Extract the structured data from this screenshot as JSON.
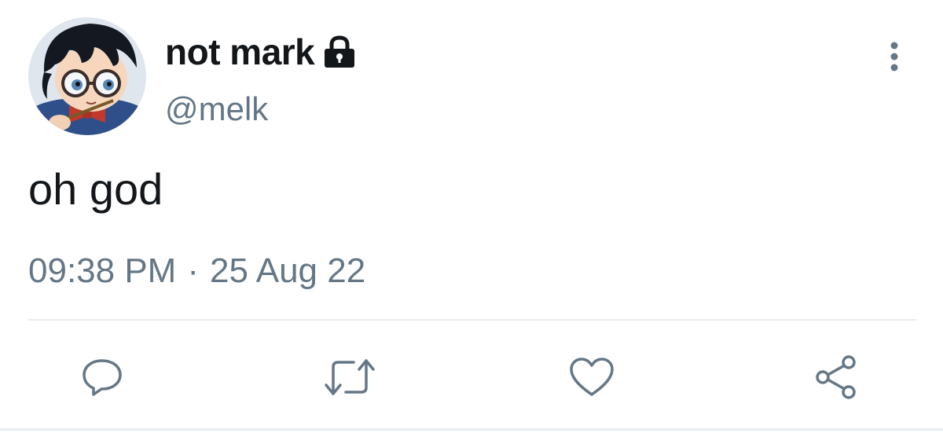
{
  "tweet": {
    "display_name": "not mark",
    "handle": "@melk",
    "text": "oh god",
    "time": "09:38 PM",
    "separator": "·",
    "date": "25 Aug 22",
    "account_protected": true
  },
  "icons": {
    "protected": "lock-icon",
    "more": "more-vertical-icon",
    "reply": "reply-icon",
    "retweet": "retweet-icon",
    "like": "heart-icon",
    "share": "share-icon"
  },
  "colors": {
    "text_primary": "#14171a",
    "text_secondary": "#657786",
    "divider": "#e6ecf0",
    "icon": "#657786"
  }
}
